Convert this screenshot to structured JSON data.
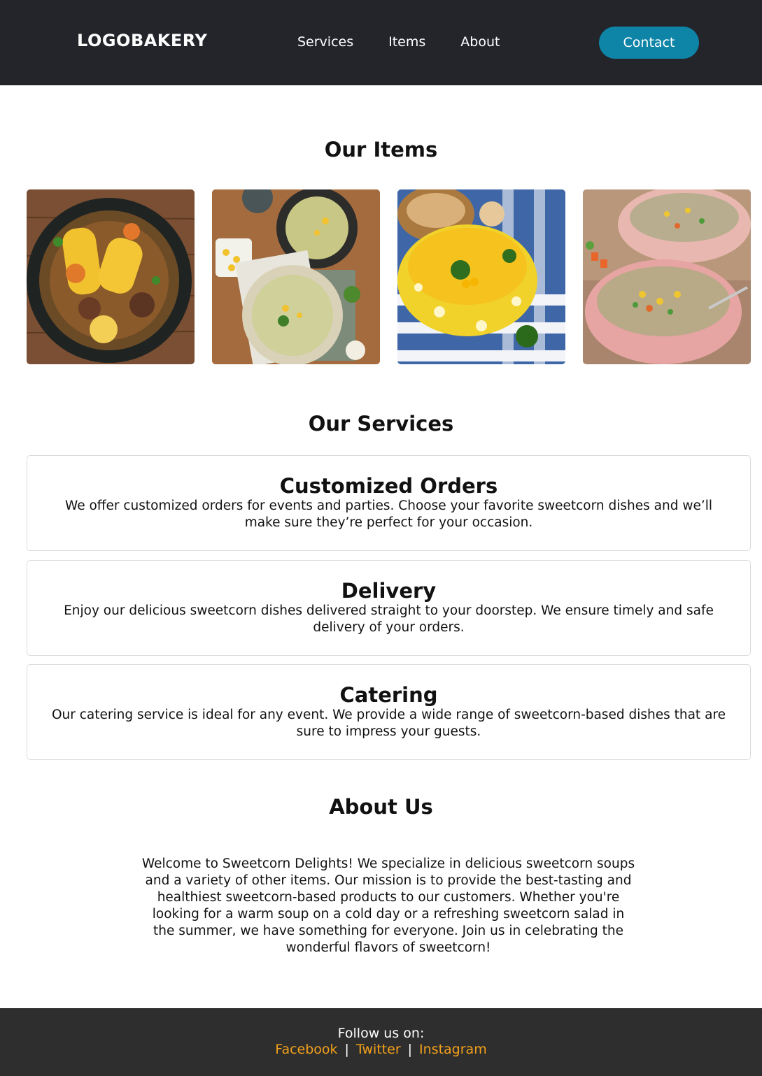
{
  "header": {
    "logo": "LOGOBAKERY",
    "nav": [
      "Services",
      "Items",
      "About"
    ],
    "contact_label": "Contact"
  },
  "colors": {
    "header_bg": "#23252b",
    "accent": "#0e84a6",
    "footer_bg": "#2e2e2e",
    "link": "#f4a11a"
  },
  "items": {
    "title": "Our Items",
    "images": [
      "corn-stew-photo",
      "creamy-corn-soup-photo",
      "yellow-corn-soup-photo",
      "corn-vegetable-soup-photo"
    ]
  },
  "services": {
    "title": "Our Services",
    "list": [
      {
        "title": "Customized Orders",
        "text": "We offer customized orders for events and parties. Choose your favorite sweetcorn dishes and we’ll make sure they’re perfect for your occasion."
      },
      {
        "title": "Delivery",
        "text": "Enjoy our delicious sweetcorn dishes delivered straight to your doorstep. We ensure timely and safe delivery of your orders."
      },
      {
        "title": "Catering",
        "text": "Our catering service is ideal for any event. We provide a wide range of sweetcorn-based dishes that are sure to impress your guests."
      }
    ]
  },
  "about": {
    "title": "About Us",
    "text": "Welcome to Sweetcorn Delights! We specialize in delicious sweetcorn soups and a variety of other items. Our mission is to provide the best-tasting and healthiest sweetcorn-based products to our customers. Whether you're looking for a warm soup on a cold day or a refreshing sweetcorn salad in the summer, we have something for everyone. Join us in celebrating the wonderful flavors of sweetcorn!"
  },
  "footer": {
    "follow": "Follow us on:",
    "links": [
      "Facebook",
      "Twitter",
      "Instagram"
    ],
    "separator": "|"
  }
}
